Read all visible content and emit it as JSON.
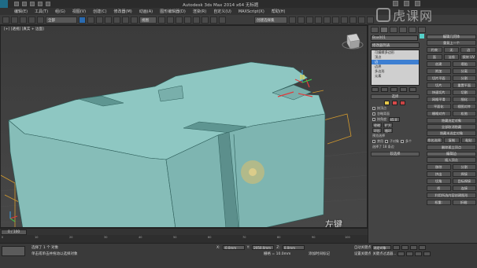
{
  "app": {
    "title": "Autodesk 3ds Max 2014 x64    无标题"
  },
  "menubar": {
    "items": [
      "编辑(E)",
      "工具(T)",
      "组(G)",
      "视图(V)",
      "创建(C)",
      "修改器(M)",
      "动画(A)",
      "图形编辑器(D)",
      "渲染(R)",
      "自定义(U)",
      "MAXScript(X)",
      "帮助(H)"
    ]
  },
  "toolbar": {
    "selection_filter": "全部",
    "view": "视图",
    "named_selection": "创建选择集"
  },
  "viewport": {
    "label": "[+] [透视] [真实 + 边面]",
    "object_color": "#7fb9b6",
    "keystrokes": [
      "左键",
      "左键",
      "左键"
    ]
  },
  "watermark": {
    "text": "虎课网"
  },
  "command_panel": {
    "object_name": "Box001",
    "object_color": "#55d0c9",
    "modifier_list": "修改器列表",
    "stack": [
      {
        "label": "可编辑多边形",
        "selected": false
      },
      {
        "label": "顶点",
        "selected": false
      },
      {
        "label": "边",
        "selected": true
      },
      {
        "label": "边界",
        "selected": false
      },
      {
        "label": "多边形",
        "selected": false
      },
      {
        "label": "元素",
        "selected": false
      }
    ],
    "selection_rollout": "选择",
    "by_vertex": "按顶点",
    "ignore_backfacing": "忽略背面",
    "by_angle": "按角度:",
    "angle_value": "45.0",
    "shrink": "收缩",
    "grow": "扩大",
    "ring": "环形",
    "loop": "循环",
    "preview_selection": "预览选择",
    "preview_off": "禁用",
    "preview_subobj": "子对象",
    "preview_multi": "多个",
    "selected_count": "选择了 18 条边",
    "soft_selection": "软选择",
    "right": {
      "edit_geometry": "编辑几何体",
      "repeat_last": "重复上一个",
      "constraints": "约束",
      "none": "无",
      "edge": "边",
      "face": "面",
      "normal": "法线",
      "preserve_uvs": "保持 UV",
      "create": "创建",
      "collapse": "塌陷",
      "attach": "附加",
      "detach": "分离",
      "slice_plane": "切片平面",
      "split": "分割",
      "slice": "切片",
      "reset_plane": "重置平面",
      "quickslice": "快速切片",
      "cut": "切割",
      "meshsmooth": "网格平滑",
      "tessellate": "细化",
      "make_planar": "平面化",
      "view_align": "视图对齐",
      "grid_align": "栅格对齐",
      "relax": "松弛",
      "hide_selected": "隐藏选定对象",
      "unhide_all": "全部取消隐藏",
      "hide_unselected": "隐藏未选定对象",
      "named_selections": "命名选择:",
      "copy": "复制",
      "paste": "粘贴",
      "delete_isolated": "删除孤立顶点",
      "edit_edges": "编辑边",
      "insert_vertex": "插入顶点",
      "remove": "移除",
      "split_edge": "分割",
      "extrude": "挤出",
      "weld": "焊接",
      "chamfer": "切角",
      "target_weld": "目标焊接",
      "bridge": "桥",
      "connect": "连接",
      "create_shape": "利用所选内容创建图形",
      "weight": "权重:",
      "crease": "折缝:"
    }
  },
  "timeline": {
    "frame": "0 / 100",
    "ticks": [
      "0",
      "10",
      "20",
      "30",
      "40",
      "50",
      "60",
      "70",
      "80",
      "90",
      "100"
    ]
  },
  "status": {
    "selection": "选择了 1 个 对象",
    "prompt": "单击或单击并拖动以选择对象",
    "x": "-0.0mm",
    "y": "2050.0mm",
    "z": "0.0mm",
    "grid": "栅格 = 10.0mm",
    "add_tag": "添加时间标记",
    "auto_key": "自动关键点",
    "set_key": "设置关键点",
    "selected": "选定对象",
    "key_filters": "关键点过滤器..."
  }
}
